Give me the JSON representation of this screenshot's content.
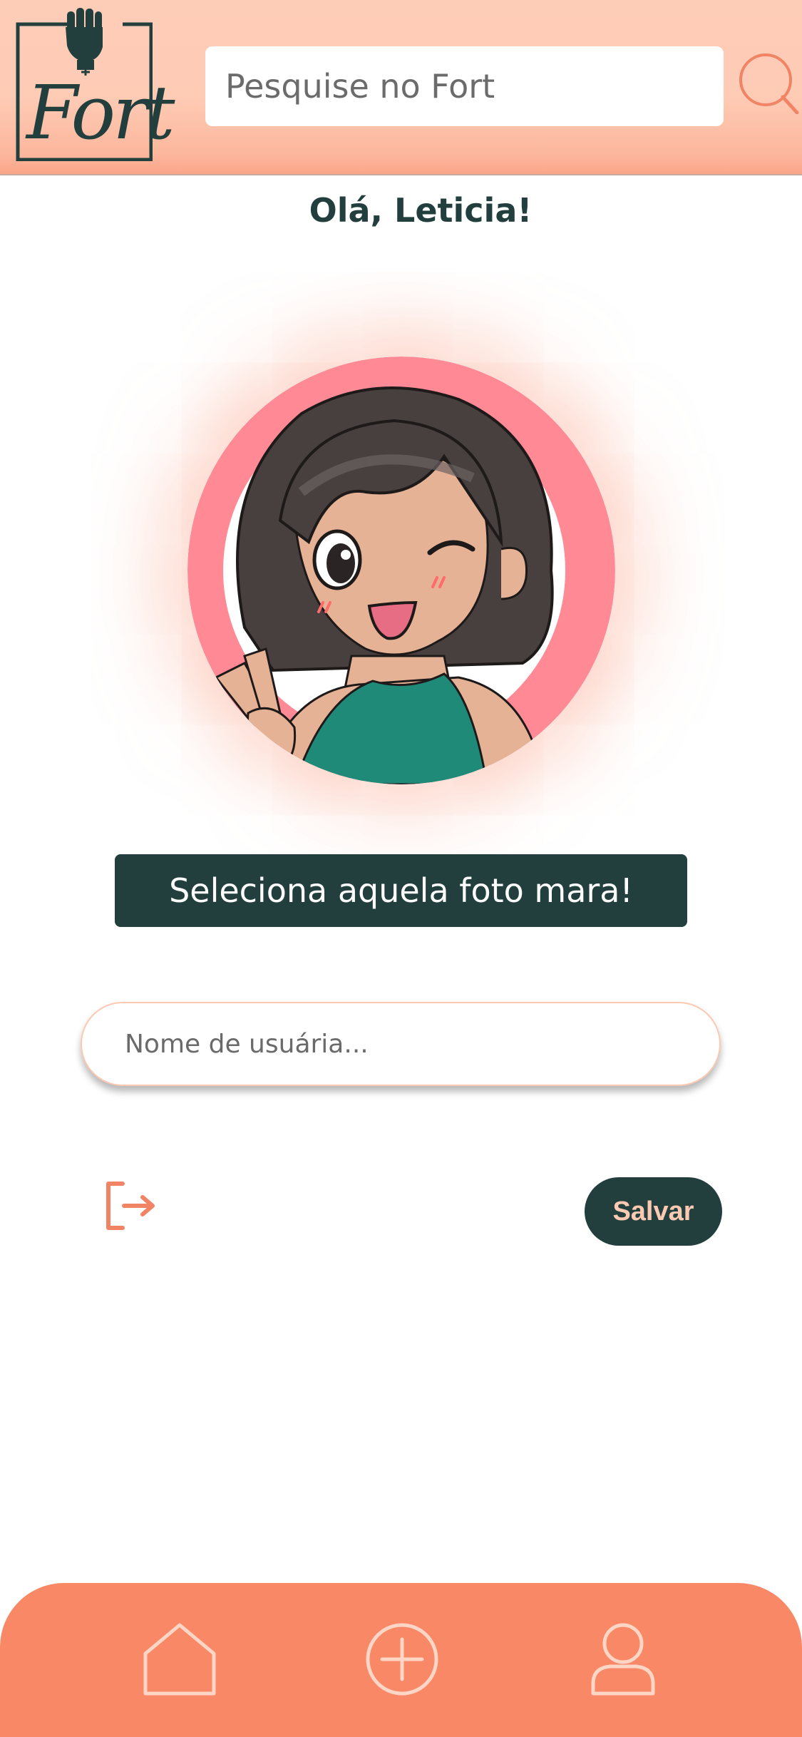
{
  "header": {
    "logo_text": "Fort",
    "search": {
      "placeholder": "Pesquise no Fort"
    }
  },
  "greeting": "Olá, Leticia!",
  "profile": {
    "select_photo_label": "Seleciona aquela foto mara!",
    "username": {
      "placeholder": "Nome de usuária...",
      "value": ""
    },
    "save_label": "Salvar"
  },
  "bottom_nav": {
    "items": [
      {
        "icon": "home-icon"
      },
      {
        "icon": "add-circle-icon"
      },
      {
        "icon": "profile-icon"
      }
    ]
  },
  "colors": {
    "header_bg": "#fecdb8",
    "dark_teal": "#223f3e",
    "accent_coral": "#f88866",
    "peach": "#fcc9b2"
  }
}
